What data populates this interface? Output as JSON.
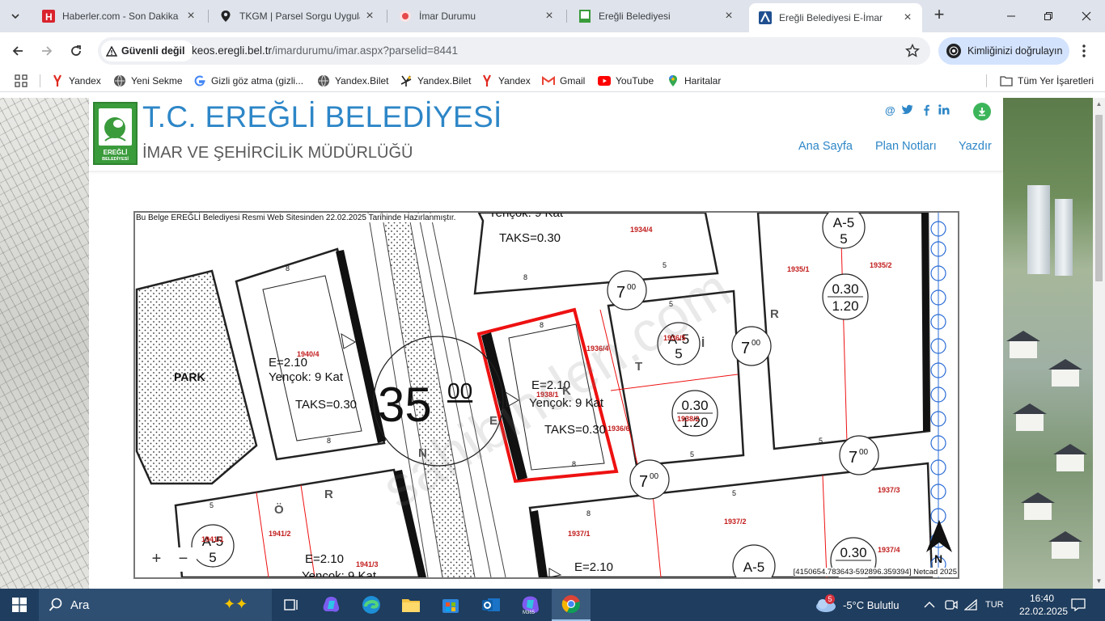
{
  "browser": {
    "tabs": [
      {
        "title": "Haberler.com - Son Dakika Haberler",
        "icon": "haberler-h-icon",
        "active": false
      },
      {
        "title": "TKGM | Parsel Sorgu Uygulaması",
        "icon": "location-pin-icon",
        "active": false
      },
      {
        "title": "İmar Durumu",
        "icon": "imar-red-icon",
        "active": false
      },
      {
        "title": "Ereğli Belediyesi",
        "icon": "eregli-logo-icon",
        "active": false
      },
      {
        "title": "Ereğli Belediyesi E-İmar",
        "icon": "netcad-icon",
        "active": true
      }
    ],
    "security_label": "Güvenli değil",
    "url_host": "keos.eregli.bel.tr",
    "url_path": "/imardurumu/imar.aspx?parselid=8441",
    "profile_label": "Kimliğinizi doğrulayın",
    "bookmarks": [
      {
        "label": "Yandex",
        "icon": "yandex-icon"
      },
      {
        "label": "Yeni Sekme",
        "icon": "globe-icon"
      },
      {
        "label": "Gizli göz atma (gizli...",
        "icon": "google-icon"
      },
      {
        "label": "Yandex.Bilet",
        "icon": "globe-icon"
      },
      {
        "label": "Yandex.Bilet",
        "icon": "yandex-bilet-icon"
      },
      {
        "label": "Yandex",
        "icon": "yandex-icon"
      },
      {
        "label": "Gmail",
        "icon": "gmail-icon"
      },
      {
        "label": "YouTube",
        "icon": "youtube-icon"
      },
      {
        "label": "Haritalar",
        "icon": "maps-icon"
      }
    ],
    "all_bookmarks_label": "Tüm Yer İşaretleri"
  },
  "site": {
    "logo_text_top": "EREĞLİ",
    "logo_text_bottom": "BELEDİYESİ",
    "title": "T.C. EREĞLİ BELEDİYESİ",
    "subtitle": "İMAR VE ŞEHİRCİLİK MÜDÜRLÜĞÜ",
    "social": [
      "@",
      "twitter-icon",
      "facebook-icon",
      "linkedin-icon"
    ],
    "nav": [
      "Ana Sayfa",
      "Plan Notları",
      "Yazdır"
    ]
  },
  "map": {
    "note": "Bu Belge EREĞLİ Belediyesi Resmi Web Sitesinden 22.02.2025 Tarihinde Hazırlanmıştır.",
    "coordinates": "[4150654.783643-592896.359394] Netcad 2025",
    "zoom_in": "+",
    "zoom_out": "−",
    "labels": {
      "park": "PARK",
      "road_width_main": "35",
      "road_width_main_sup": "00",
      "road_width_side": "7",
      "road_width_side_sup": "00",
      "emsal": "E=2.10",
      "yencok": "Yençok: 9 Kat",
      "taks": "TAKS=0.30",
      "ratio_top": "0.30",
      "ratio_bottom": "1.20",
      "a5_top": "A-5",
      "a5_bottom": "5",
      "north": "N",
      "watermark": "sahibinden.com",
      "parcels": [
        "1934/4",
        "1935/1",
        "1935/2",
        "1940/4",
        "1936/4",
        "1936/5",
        "1938/1",
        "1936/6",
        "1938/2",
        "1937/3",
        "1937/2",
        "1937/1",
        "1941/1",
        "1941/2",
        "1941/3",
        "1937/4"
      ],
      "setback_8": "8",
      "setback_5": "5",
      "street_letters": [
        "Ö",
        "R",
        "N",
        "E",
        "K",
        "T",
        "İ",
        "R"
      ]
    }
  },
  "taskbar": {
    "search_placeholder": "Ara",
    "weather": "-5°C  Bulutlu",
    "weather_badge": "5",
    "lang": "TUR",
    "time": "16:40",
    "date": "22.02.2025"
  }
}
